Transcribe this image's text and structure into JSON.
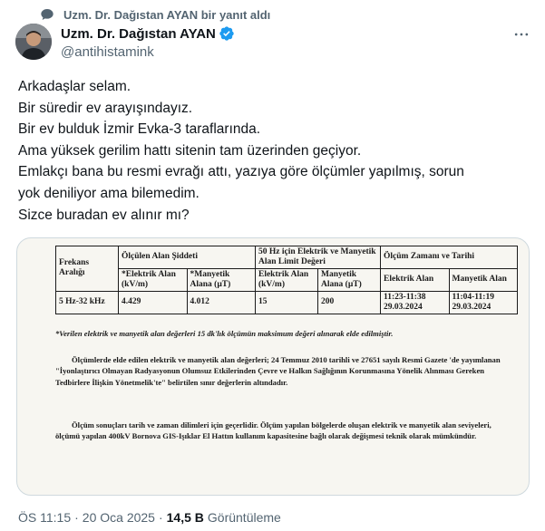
{
  "social_context": {
    "text": "Uzm. Dr. Dağıstan AYAN bir yanıt aldı",
    "icon": "speech-bubble-icon"
  },
  "author": {
    "display_name": "Uzm. Dr. Dağıstan AYAN",
    "handle": "@antihistamink",
    "verified_color": "#1d9bf0"
  },
  "tweet": {
    "lines": [
      "Arkadaşlar selam.",
      "Bir süredir ev arayışındayız.",
      "Bir ev bulduk İzmir Evka-3 taraflarında.",
      "Ama yüksek gerilim hattı sitenin tam üzerinden geçiyor.",
      "Emlakçı bana bu resmi evrağı attı, yazıya göre ölçümler yapılmış, sorun",
      "yok deniliyor ama bilemedim.",
      "Sizce buradan ev alınır mı?"
    ]
  },
  "document": {
    "h_frekans": "Frekans",
    "h_araligi": "Aralığı",
    "h_olculen": "Ölçülen Alan Şiddeti",
    "h_limit": "50 Hz için Elektrik ve Manyetik Alan Limit Değeri",
    "h_zaman": "Ölçüm Zamanı ve Tarihi",
    "h_elektrik": "*Elektrik Alan (kV/m)",
    "h_manyetik": "*Manyetik Alana (µT)",
    "h_elektrik2": "Elektrik Alan (kV/m)",
    "h_manyetik2": "Manyetik Alana (µT)",
    "h_elektrik3": "Elektrik Alan",
    "h_manyetik3": "Manyetik Alan",
    "row_freq": "5 Hz-32 kHz",
    "row_e": "4.429",
    "row_m": "4.012",
    "row_e_lim": "15",
    "row_m_lim": "200",
    "row_t1a": "11:23-11:38",
    "row_t1b": "29.03.2024",
    "row_t2a": "11:04-11:19",
    "row_t2b": "29.03.2024",
    "note": "*Verilen elektrik ve manyetik alan değerleri 15 dk'lık ölçümün maksimum değeri alınarak elde edilmiştir.",
    "para1": "Ölçümlerde elde edilen elektrik ve manyetik alan değerleri; 24 Temmuz 2010 tarihli ve 27651 sayılı Resmi Gazete 'de yayımlanan \"İyonlaştırıcı Olmayan Radyasyonun Olumsuz Etkilerinden Çevre ve Halkın Sağlığının Korunmasına Yönelik Alınması Gereken Tedbirlere İlişkin Yönetmelik'te\" belirtilen sınır değerlerin altındadır.",
    "para2": "Ölçüm sonuçları tarih ve zaman dilimleri için geçerlidir. Ölçüm yapılan bölgelerde oluşan elektrik ve manyetik alan seviyeleri, ölçümü yapılan 400kV Bornova GIS-Işıklar El Hattın kullanım kapasitesine bağlı olarak değişmesi teknik olarak mümkündür."
  },
  "meta": {
    "time": "ÖS 11:15",
    "date": "20 Oca 2025",
    "separator": "·",
    "views": "14,5 B",
    "views_label": "Görüntüleme"
  }
}
